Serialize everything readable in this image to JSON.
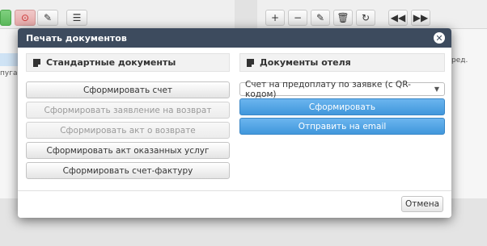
{
  "background": {
    "left_toolbar_icons": [
      "add-icon",
      "history-icon",
      "edit-icon",
      "list-icon"
    ],
    "right_toolbar_icons": [
      "plus-icon",
      "minus-icon",
      "pencil-icon",
      "trash-icon",
      "refresh-icon",
      "prev-icon",
      "next-icon"
    ],
    "left_text": "пугай",
    "right_text": "ред."
  },
  "modal": {
    "title": "Печать документов",
    "close_symbol": "✕",
    "standard": {
      "header": "Стандартные документы",
      "buttons": [
        {
          "label": "Сформировать счет",
          "enabled": true
        },
        {
          "label": "Сформировать заявление на возврат",
          "enabled": false
        },
        {
          "label": "Сформировать акт о возврате",
          "enabled": false
        },
        {
          "label": "Сформировать акт оказанных услуг",
          "enabled": true
        },
        {
          "label": "Сформировать счет-фактуру",
          "enabled": true
        }
      ]
    },
    "hotel": {
      "header": "Документы отеля",
      "select_value": "Счет на предоплату по заявке (с QR-кодом)",
      "generate_label": "Сформировать",
      "email_label": "Отправить на email"
    },
    "footer": {
      "cancel_label": "Отмена"
    }
  },
  "colors": {
    "header_bg": "#3d4b5e",
    "primary": "#4a9fe0"
  }
}
